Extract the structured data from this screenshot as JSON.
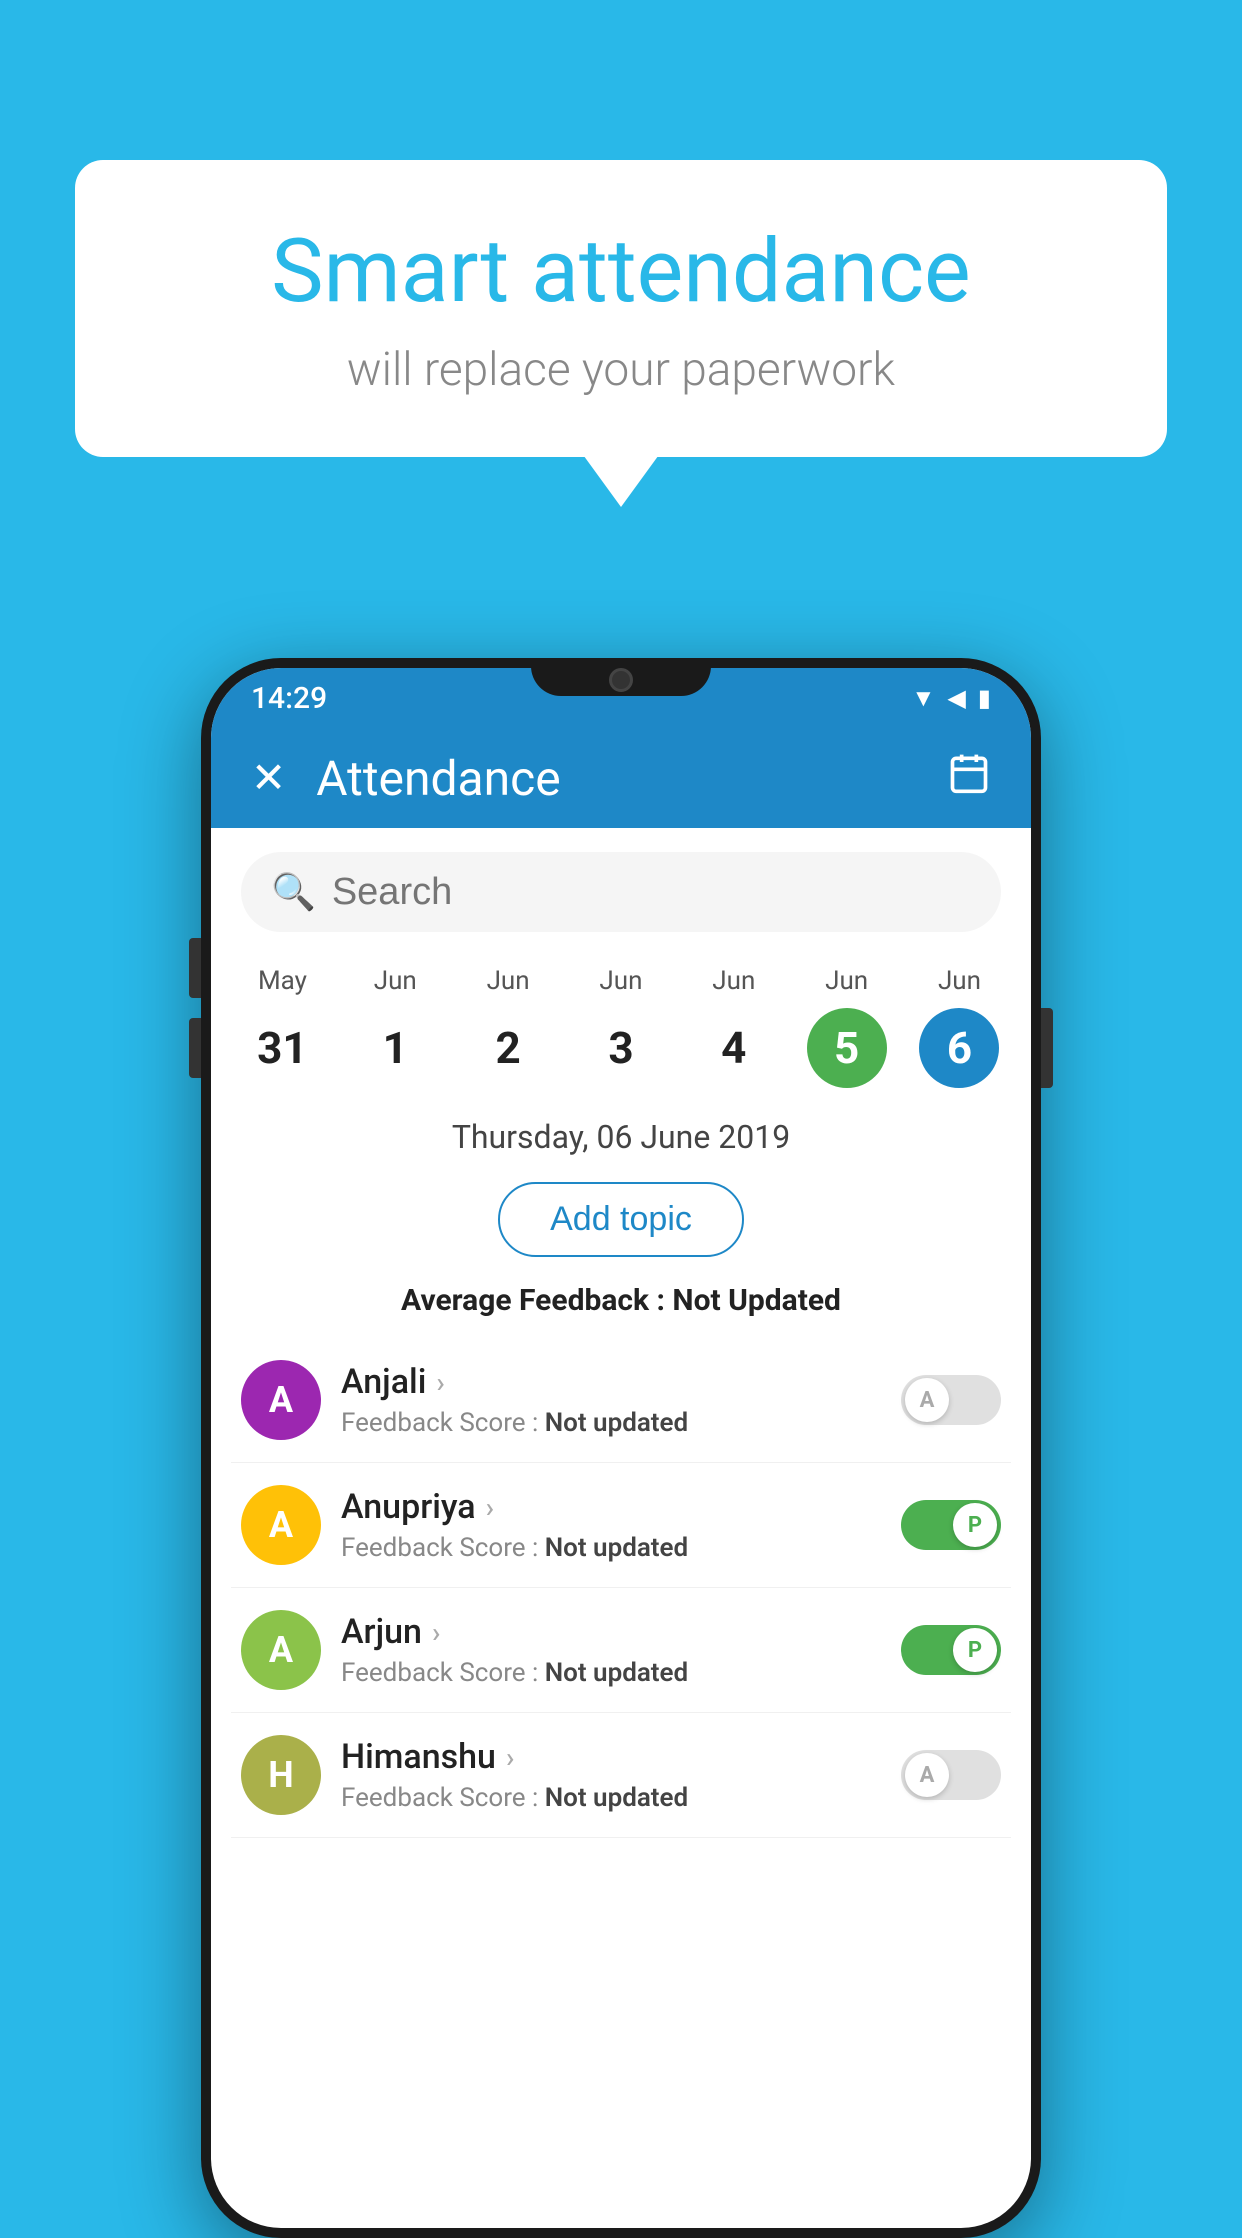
{
  "background_color": "#29b8e8",
  "speech_bubble": {
    "title": "Smart attendance",
    "subtitle": "will replace your paperwork"
  },
  "status_bar": {
    "time": "14:29",
    "icons": [
      "wifi",
      "signal",
      "battery"
    ]
  },
  "header": {
    "close_icon": "✕",
    "title": "Attendance",
    "calendar_icon": "📅"
  },
  "search": {
    "placeholder": "Search"
  },
  "dates": [
    {
      "month": "May",
      "day": "31",
      "style": "normal"
    },
    {
      "month": "Jun",
      "day": "1",
      "style": "normal"
    },
    {
      "month": "Jun",
      "day": "2",
      "style": "normal"
    },
    {
      "month": "Jun",
      "day": "3",
      "style": "normal"
    },
    {
      "month": "Jun",
      "day": "4",
      "style": "normal"
    },
    {
      "month": "Jun",
      "day": "5",
      "style": "active-green"
    },
    {
      "month": "Jun",
      "day": "6",
      "style": "active-blue"
    }
  ],
  "selected_date_label": "Thursday, 06 June 2019",
  "add_topic_label": "Add topic",
  "avg_feedback": {
    "label": "Average Feedback : ",
    "value": "Not Updated"
  },
  "students": [
    {
      "name": "Anjali",
      "avatar_letter": "A",
      "avatar_color": "#9c27b0",
      "feedback_label": "Feedback Score : ",
      "feedback_value": "Not updated",
      "toggle": "off",
      "toggle_label": "A"
    },
    {
      "name": "Anupriya",
      "avatar_letter": "A",
      "avatar_color": "#ffc107",
      "feedback_label": "Feedback Score : ",
      "feedback_value": "Not updated",
      "toggle": "on",
      "toggle_label": "P"
    },
    {
      "name": "Arjun",
      "avatar_letter": "A",
      "avatar_color": "#8bc34a",
      "feedback_label": "Feedback Score : ",
      "feedback_value": "Not updated",
      "toggle": "on",
      "toggle_label": "P"
    },
    {
      "name": "Himanshu",
      "avatar_letter": "H",
      "avatar_color": "#aab04a",
      "feedback_label": "Feedback Score : ",
      "feedback_value": "Not updated",
      "toggle": "off",
      "toggle_label": "A"
    }
  ]
}
